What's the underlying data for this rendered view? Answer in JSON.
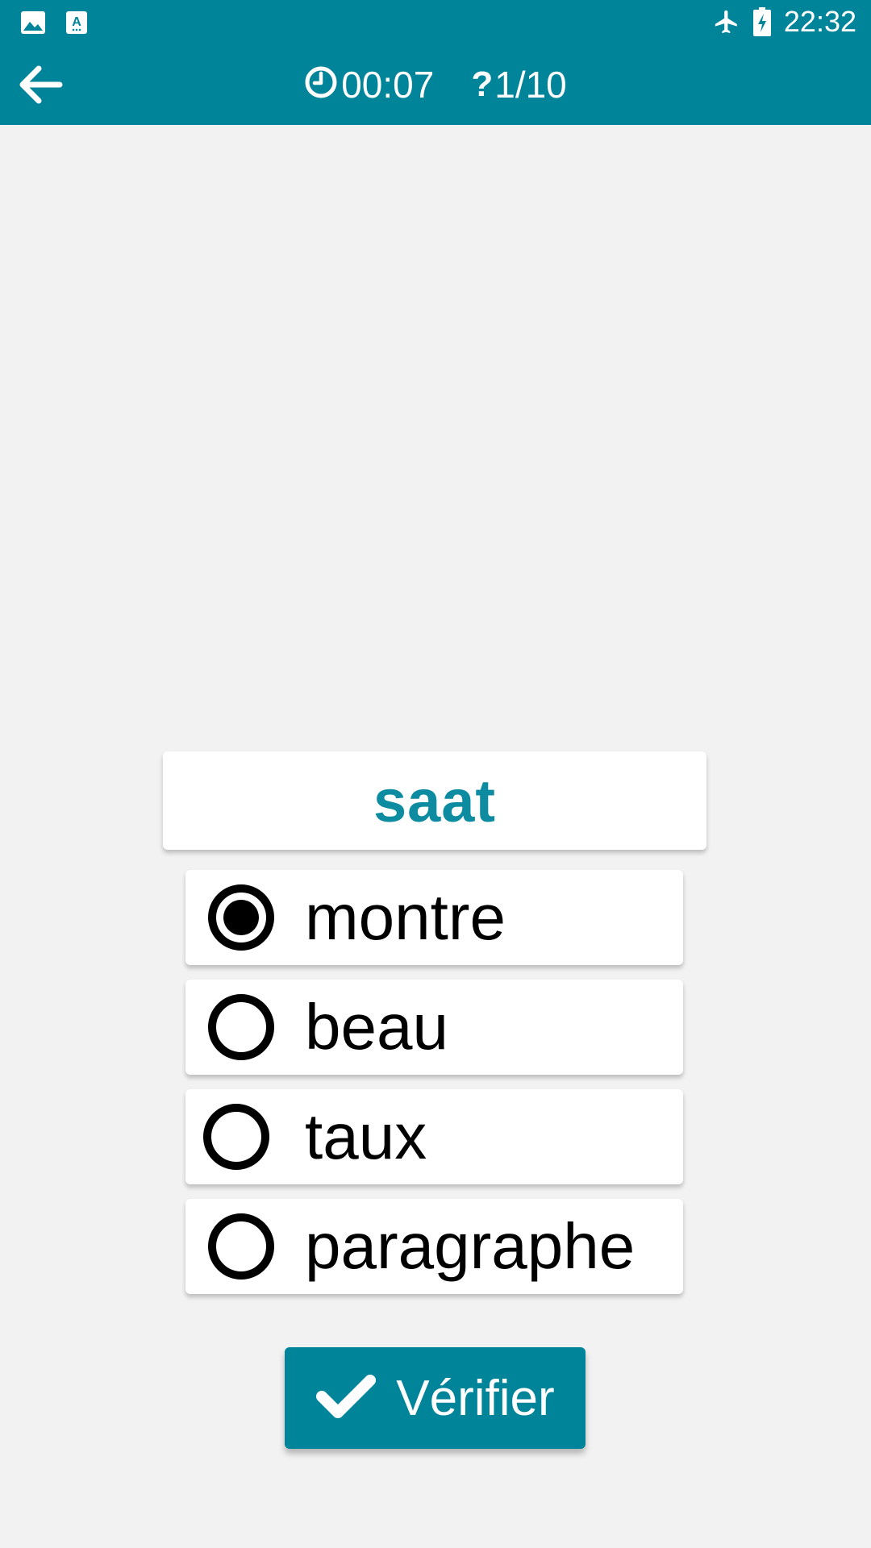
{
  "status_bar": {
    "time": "22:32",
    "icons": [
      "image-notification-icon",
      "translate-notification-icon",
      "airplane-mode-icon",
      "battery-charging-icon"
    ]
  },
  "app_bar": {
    "back_icon": "arrow-left-icon",
    "timer_icon": "clock-icon",
    "timer": "00:07",
    "progress_icon": "question-mark-icon",
    "progress": "1/10"
  },
  "quiz": {
    "word": "saat",
    "options": [
      {
        "label": "montre",
        "selected": true
      },
      {
        "label": "beau",
        "selected": false
      },
      {
        "label": "taux",
        "selected": false
      },
      {
        "label": "paragraphe",
        "selected": false
      }
    ]
  },
  "verify_button": {
    "label": "Vérifier",
    "icon": "checkmark-icon"
  },
  "colors": {
    "primary": "#00849a",
    "word_text": "#0d8ba0",
    "background": "#f2f2f2"
  }
}
